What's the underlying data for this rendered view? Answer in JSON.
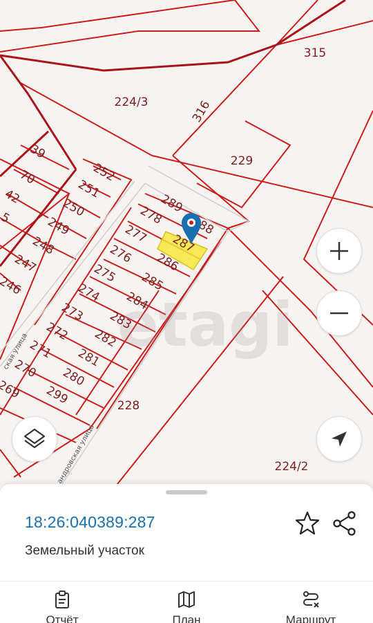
{
  "map": {
    "plots": [
      "315",
      "224/3",
      "316",
      "229",
      "39",
      "70",
      "42",
      "252",
      "251",
      "250",
      "249",
      "248",
      "247",
      "246",
      "289",
      "278",
      "288",
      "277",
      "287",
      "276",
      "286",
      "275",
      "285",
      "274",
      "284",
      "273",
      "283",
      "272",
      "282",
      "271",
      "281",
      "270",
      "280",
      "269",
      "299",
      "228",
      "224/2",
      "5"
    ],
    "streets": [
      "ская улица",
      "андровская улица"
    ],
    "watermark": "etagi",
    "selected_plot": "287",
    "colors": {
      "boundary": "#c81e1e",
      "road": "#a8141a",
      "selected_fill": "#f5e63c",
      "marker": "#1a6fb0"
    }
  },
  "controls": {
    "zoom_in_icon": "plus-icon",
    "zoom_out_icon": "minus-icon",
    "locate_icon": "navigation-arrow-icon",
    "layers_icon": "layers-icon"
  },
  "details": {
    "cadastral_number": "18:26:040389:287",
    "object_type": "Земельный участок"
  },
  "tabs": [
    {
      "label": "Отчёт",
      "icon": "report-icon"
    },
    {
      "label": "План",
      "icon": "map-plan-icon"
    },
    {
      "label": "Маршрут",
      "icon": "route-icon"
    }
  ]
}
